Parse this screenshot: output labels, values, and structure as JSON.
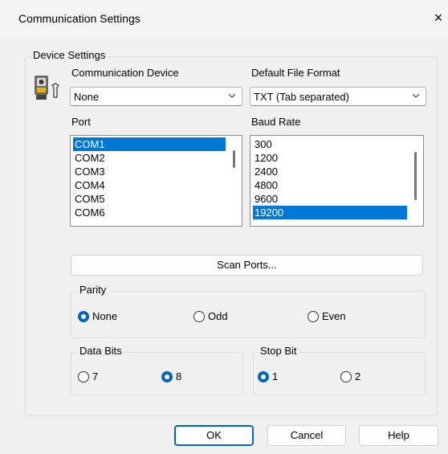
{
  "window": {
    "title": "Communication Settings",
    "close_glyph": "×"
  },
  "device_settings": {
    "group_label": "Device Settings",
    "comm_device": {
      "label": "Communication Device",
      "value": "None"
    },
    "file_format": {
      "label": "Default File Format",
      "value": "TXT (Tab separated)"
    },
    "port": {
      "label": "Port",
      "items": [
        "COM1",
        "COM2",
        "COM3",
        "COM4",
        "COM5",
        "COM6"
      ],
      "selected": "COM1"
    },
    "baud": {
      "label": "Baud Rate",
      "items": [
        "300",
        "1200",
        "2400",
        "4800",
        "9600",
        "19200"
      ],
      "selected": "19200"
    },
    "scan_button": "Scan Ports...",
    "parity": {
      "label": "Parity",
      "options": [
        "None",
        "Odd",
        "Even"
      ],
      "selected": "None"
    },
    "data_bits": {
      "label": "Data Bits",
      "options": [
        "7",
        "8"
      ],
      "selected": "8"
    },
    "stop_bit": {
      "label": "Stop Bit",
      "options": [
        "1",
        "2"
      ],
      "selected": "1"
    }
  },
  "buttons": {
    "ok": "OK",
    "cancel": "Cancel",
    "help": "Help"
  },
  "icons": {
    "device": "surveying-instrument-icon",
    "dropdown": "chevron-down-icon"
  },
  "colors": {
    "accent": "#0078d7",
    "radio": "#0067c0"
  }
}
